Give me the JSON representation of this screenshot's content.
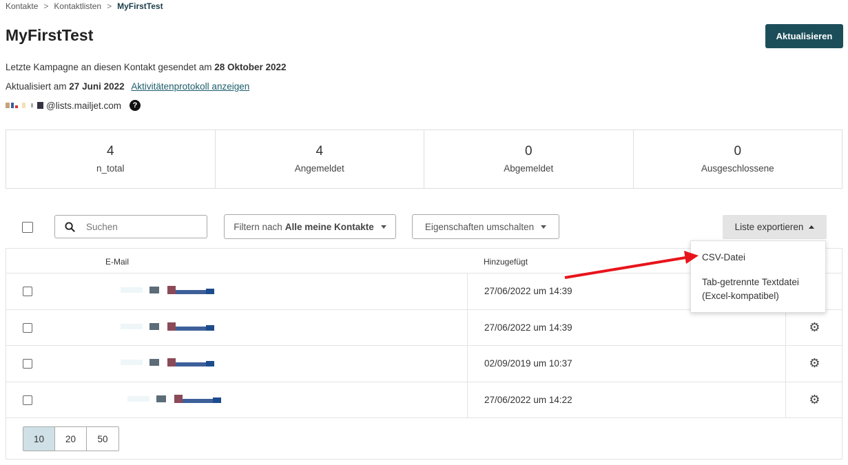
{
  "breadcrumb": {
    "items": [
      "Kontakte",
      "Kontaktlisten"
    ],
    "current": "MyFirstTest",
    "separator": ">"
  },
  "header": {
    "title": "MyFirstTest",
    "update_button": "Aktualisieren"
  },
  "info": {
    "last_campaign_prefix": "Letzte Kampagne an diesen Kontakt gesendet am",
    "last_campaign_date": "28 Oktober 2022",
    "updated_prefix": "Aktualisiert am",
    "updated_date": "27 Juni 2022",
    "activity_link": "Aktivitätenprotokoll anzeigen",
    "email_domain": "@lists.mailjet.com",
    "help_glyph": "?"
  },
  "stats": [
    {
      "value": "4",
      "label": "n_total"
    },
    {
      "value": "4",
      "label": "Angemeldet"
    },
    {
      "value": "0",
      "label": "Abgemeldet"
    },
    {
      "value": "0",
      "label": "Ausgeschlossene"
    }
  ],
  "toolbar": {
    "search_placeholder": "Suchen",
    "filter_prefix": "Filtern nach",
    "filter_value": "Alle meine Kontakte",
    "toggle_properties": "Eigenschaften umschalten",
    "export": "Liste exportieren"
  },
  "export_menu": {
    "items": [
      "CSV-Datei",
      "Tab-getrennte Textdatei (Excel-kompatibel)"
    ]
  },
  "table": {
    "columns": [
      "E-Mail",
      "Hinzugefügt"
    ],
    "rows": [
      {
        "added": "27/06/2022 um 14:39"
      },
      {
        "added": "27/06/2022 um 14:39"
      },
      {
        "added": "02/09/2019 um 10:37"
      },
      {
        "added": "27/06/2022 um 14:22"
      }
    ]
  },
  "pagination": {
    "sizes": [
      "10",
      "20",
      "50"
    ],
    "active": "10"
  },
  "colors": {
    "primary": "#1c4e5a",
    "annotation_arrow": "#e8141b",
    "pager_active": "#cfe0e6"
  },
  "icons": {
    "search": "search-icon",
    "gear": "gear-icon",
    "help": "help-icon",
    "caret": "caret-down-icon"
  }
}
